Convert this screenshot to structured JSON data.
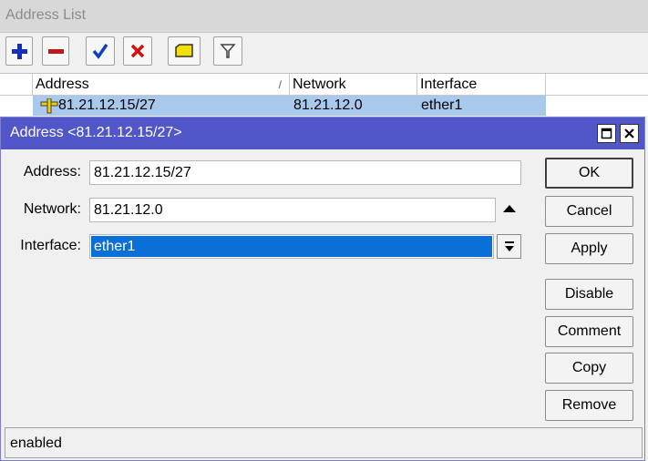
{
  "list_window": {
    "title": "Address List",
    "toolbar": [
      {
        "name": "add-icon",
        "color": "#1030c0"
      },
      {
        "name": "remove-icon",
        "color": "#c01818"
      },
      {
        "name": "enable-check-icon",
        "color": "#1040c0"
      },
      {
        "name": "disable-x-icon",
        "color": "#d01010"
      },
      {
        "name": "comment-note-icon",
        "color": "#f2e000"
      },
      {
        "name": "filter-icon",
        "color": "#404040"
      }
    ],
    "columns": [
      "Address",
      "Network",
      "Interface"
    ],
    "sort_indicator": "/",
    "rows": [
      {
        "address": "81.21.12.15/27",
        "network": "81.21.12.0",
        "interface": "ether1",
        "icon": "plus-address-icon"
      }
    ],
    "selection_color": "#a8c8ec"
  },
  "dialog": {
    "title": "Address <81.21.12.15/27>",
    "title_bar_color": "#5157c8",
    "fields": {
      "address": {
        "label": "Address:",
        "value": "81.21.12.15/27"
      },
      "network": {
        "label": "Network:",
        "value": "81.21.12.0"
      },
      "interface": {
        "label": "Interface:",
        "value": "ether1"
      }
    },
    "buttons": {
      "ok": "OK",
      "cancel": "Cancel",
      "apply": "Apply",
      "disable": "Disable",
      "comment": "Comment",
      "copy": "Copy",
      "remove": "Remove"
    },
    "status": "enabled"
  }
}
